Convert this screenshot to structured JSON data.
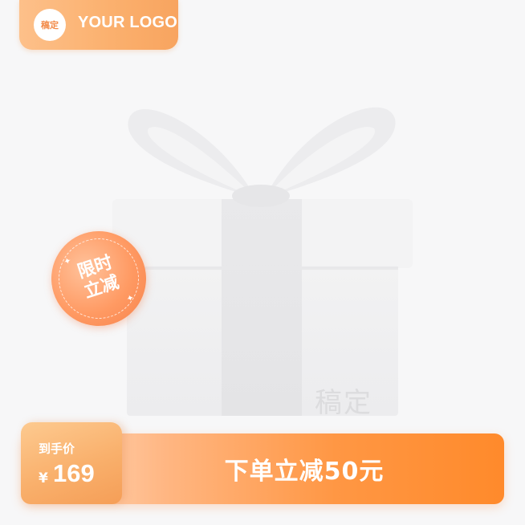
{
  "logo": {
    "mark": "稿定",
    "text": "YOUR LOGO"
  },
  "gift": {
    "watermark": "稿定"
  },
  "sticker": {
    "line1": "限时",
    "line2": "立减"
  },
  "price": {
    "label": "到手价",
    "currency": "¥",
    "value": "169"
  },
  "promo": {
    "text": "下单立减50元"
  },
  "colors": {
    "accent": "#ff8a2b",
    "accent_light": "#fdc08a",
    "background": "#f7f7f8"
  }
}
